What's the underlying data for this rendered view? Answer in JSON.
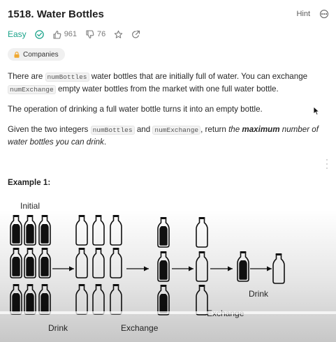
{
  "problem": {
    "title": "1518. Water Bottles",
    "hint_label": "Hint",
    "difficulty": "Easy",
    "likes": "961",
    "dislikes": "76",
    "companies_label": "Companies"
  },
  "description": {
    "p1_a": "There are ",
    "p1_code1": "numBottles",
    "p1_b": " water bottles that are initially full of water. You can exchange ",
    "p1_code2": "numExchange",
    "p1_c": " empty water bottles from the market with one full water bottle.",
    "p2": "The operation of drinking a full water bottle turns it into an empty bottle.",
    "p3_a": "Given the two integers ",
    "p3_code1": "numBottles",
    "p3_b": " and ",
    "p3_code2": "numExchange",
    "p3_c": ", return ",
    "p3_em1": "the ",
    "p3_strong": "maximum",
    "p3_em2": " number of water bottles you can drink",
    "p3_d": "."
  },
  "example": {
    "heading": "Example 1:",
    "label_initial": "Initial",
    "label_drink1": "Drink",
    "label_exchange1": "Exchange",
    "label_exchange2": "Exchange",
    "label_drink2": "Drink"
  },
  "colors": {
    "accent_easy": "#1aa38a",
    "bottle_fill": "#111111"
  }
}
